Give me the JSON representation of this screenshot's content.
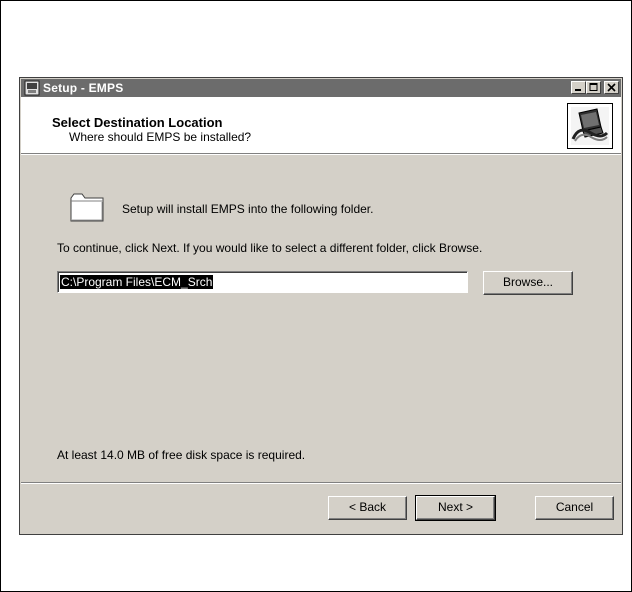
{
  "window": {
    "title": "Setup - EMPS",
    "minimize_glyph": "_",
    "maximize_glyph": "□",
    "close_glyph": "×"
  },
  "header": {
    "title": "Select Destination Location",
    "subtitle": "Where should EMPS be installed?",
    "image_icon": "installer-computer-icon"
  },
  "body": {
    "folder_icon": "folder-icon",
    "install_text": "Setup will install EMPS into the following folder.",
    "continue_text": "To continue, click Next. If you would like to select a different folder, click Browse.",
    "path_value": "C:\\Program Files\\ECM_Srch",
    "browse_label": "Browse...",
    "space_text": "At least 14.0 MB of free disk space is required."
  },
  "footer": {
    "back_label": "< Back",
    "next_label": "Next >",
    "cancel_label": "Cancel"
  }
}
